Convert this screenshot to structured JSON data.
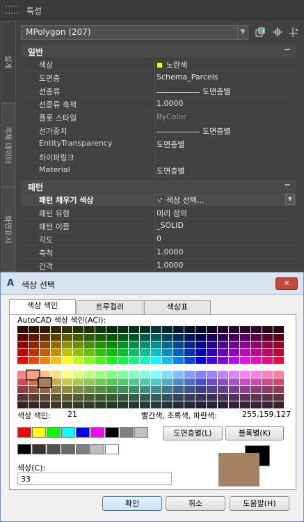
{
  "palette": {
    "title": "특성",
    "side_tabs": [
      "설계",
      "객체 데이터",
      "화면표시"
    ],
    "object_select": "MPolygon (207)",
    "categories": [
      {
        "name": "일반",
        "collapse": "−",
        "rows": [
          {
            "label": "색상",
            "value": "노란색",
            "swatch": "#ffff00"
          },
          {
            "label": "도면층",
            "value": "Schema_Parcels"
          },
          {
            "label": "선종류",
            "value": "도면층별",
            "line": true
          },
          {
            "label": "선종류 축척",
            "value": "1.0000"
          },
          {
            "label": "플롯 스타일",
            "value": "ByColor",
            "grey": true
          },
          {
            "label": "선가중치",
            "value": "도면층별",
            "line": true
          },
          {
            "label": "EntityTransparency",
            "value": "도면층별"
          },
          {
            "label": "하이퍼링크",
            "value": ""
          },
          {
            "label": "Material",
            "value": "도면층별"
          }
        ]
      },
      {
        "name": "패턴",
        "collapse": "−",
        "rows": [
          {
            "label": "패턴 채우기 색상",
            "value": "색상 선택...",
            "selected": true,
            "dropdown": true,
            "swatch_icon": true
          },
          {
            "label": "패턴 유형",
            "value": "미리 정의"
          },
          {
            "label": "패턴 이름",
            "value": "_SOLID"
          },
          {
            "label": "각도",
            "value": "0"
          },
          {
            "label": "축척",
            "value": "1.0000"
          },
          {
            "label": "간격",
            "value": "1.0000"
          }
        ]
      }
    ]
  },
  "dialog": {
    "title": "색상 선택",
    "close": "✕",
    "tabs": [
      "색상 색인",
      "트루컬러",
      "색상표"
    ],
    "aci_label": "AutoCAD 색상 색인(ACI):",
    "index_label": "색상 색인:",
    "index_value": "21",
    "rgb_label": "빨간색, 초록색, 파란색:",
    "rgb_value": "255,159,127",
    "bylayer_button": "도면층별(L)",
    "byblock_button": "블록별(K)",
    "color_label": "색상(C):",
    "color_value": "33",
    "ok_button": "확인",
    "cancel_button": "취소",
    "help_button": "도움말(H)",
    "selected_hover_color": "#ff9f7f",
    "selected_color": "#a5825f",
    "standard_colors": [
      "#ff0000",
      "#ffff00",
      "#00ff00",
      "#00ffff",
      "#0000ff",
      "#ff00ff",
      "#000000",
      "#808080",
      "#c0c0c0"
    ],
    "gray_colors": [
      "#000000",
      "#333333",
      "#505050",
      "#696969",
      "#808080",
      "#bebebe",
      "#ffffff"
    ]
  }
}
